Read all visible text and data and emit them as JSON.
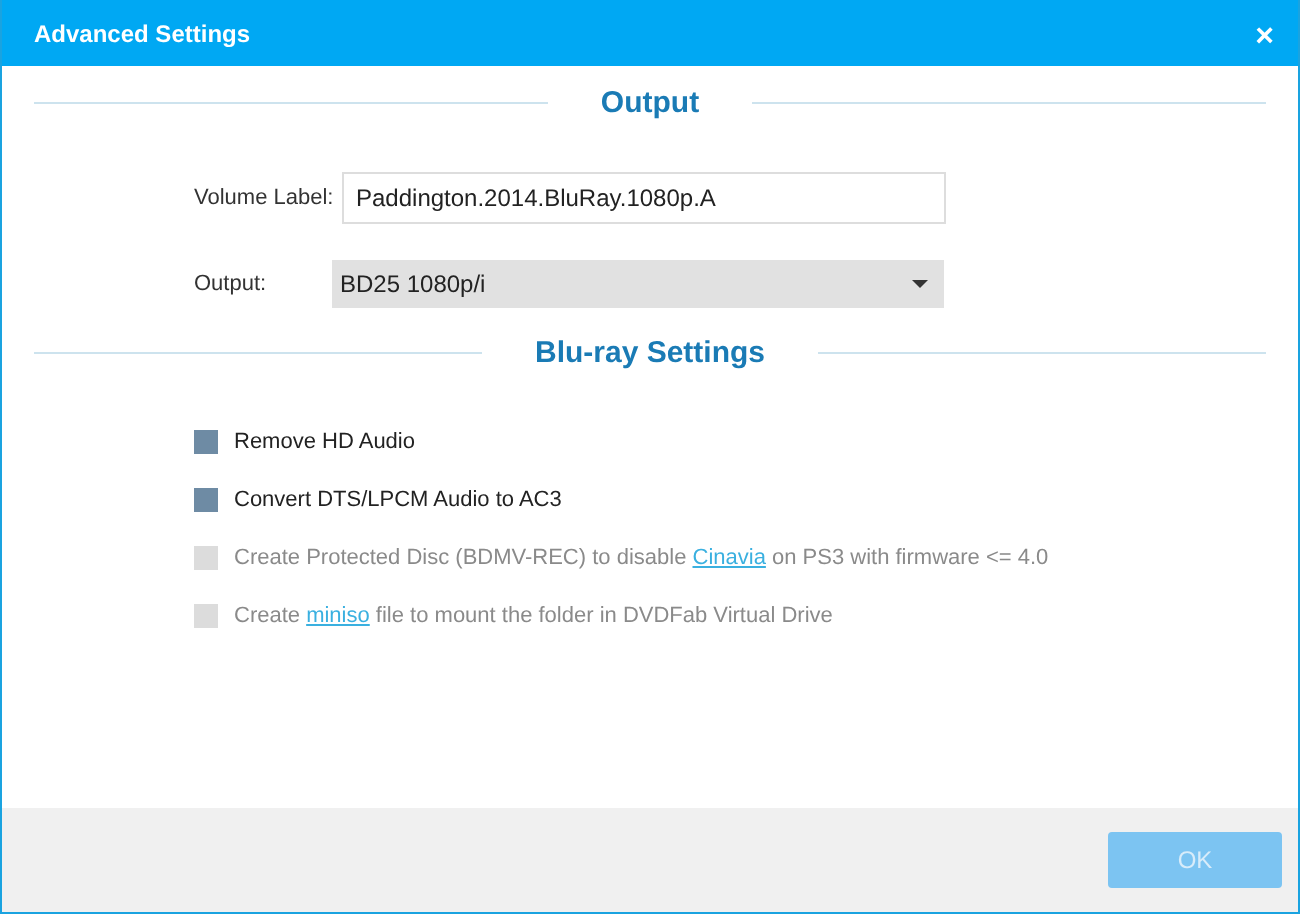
{
  "window": {
    "title": "Advanced Settings",
    "close": "×"
  },
  "output_section": {
    "heading": "Output",
    "volume_label": {
      "label": "Volume Label:",
      "value": "Paddington.2014.BluRay.1080p.A"
    },
    "output": {
      "label": "Output:",
      "value": "BD25 1080p/i"
    }
  },
  "bluray_section": {
    "heading": "Blu-ray Settings",
    "options": [
      {
        "checked": true,
        "disabled": false,
        "parts": [
          {
            "kind": "text",
            "text": "Remove HD Audio"
          }
        ]
      },
      {
        "checked": true,
        "disabled": false,
        "parts": [
          {
            "kind": "text",
            "text": "Convert DTS/LPCM Audio to AC3"
          }
        ]
      },
      {
        "checked": false,
        "disabled": true,
        "parts": [
          {
            "kind": "text",
            "text": "Create Protected Disc (BDMV-REC) to disable "
          },
          {
            "kind": "link",
            "text": "Cinavia"
          },
          {
            "kind": "text",
            "text": " on PS3 with firmware <= 4.0"
          }
        ]
      },
      {
        "checked": false,
        "disabled": true,
        "parts": [
          {
            "kind": "text",
            "text": "Create "
          },
          {
            "kind": "link",
            "text": "miniso"
          },
          {
            "kind": "text",
            "text": " file to mount the folder in DVDFab Virtual Drive"
          }
        ]
      }
    ]
  },
  "buttons": [
    {
      "label": "OK",
      "disabled": true
    }
  ]
}
